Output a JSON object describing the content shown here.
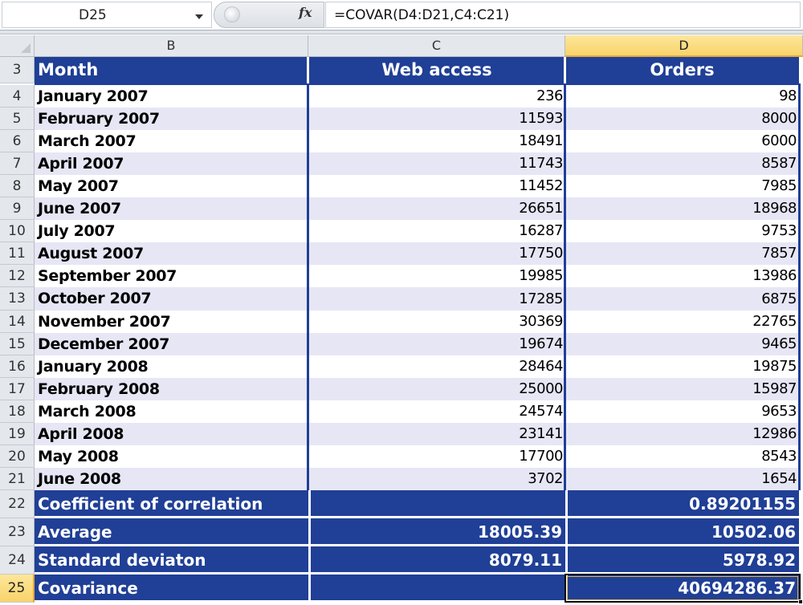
{
  "formula_bar": {
    "name_box": "D25",
    "fx_label": "fx",
    "formula": "=COVAR(D4:D21,C4:C21)"
  },
  "columns": [
    {
      "letter": "B",
      "selected": false
    },
    {
      "letter": "C",
      "selected": false
    },
    {
      "letter": "D",
      "selected": true
    }
  ],
  "header_row": {
    "row_number": "3",
    "month": "Month",
    "web_access": "Web access",
    "orders": "Orders"
  },
  "rows": [
    {
      "row": "4",
      "month": "January 2007",
      "web": "236",
      "orders": "98"
    },
    {
      "row": "5",
      "month": "February 2007",
      "web": "11593",
      "orders": "8000"
    },
    {
      "row": "6",
      "month": "March 2007",
      "web": "18491",
      "orders": "6000"
    },
    {
      "row": "7",
      "month": "April 2007",
      "web": "11743",
      "orders": "8587"
    },
    {
      "row": "8",
      "month": "May 2007",
      "web": "11452",
      "orders": "7985"
    },
    {
      "row": "9",
      "month": "June 2007",
      "web": "26651",
      "orders": "18968"
    },
    {
      "row": "10",
      "month": "July 2007",
      "web": "16287",
      "orders": "9753"
    },
    {
      "row": "11",
      "month": "August 2007",
      "web": "17750",
      "orders": "7857"
    },
    {
      "row": "12",
      "month": "September 2007",
      "web": "19985",
      "orders": "13986"
    },
    {
      "row": "13",
      "month": "October 2007",
      "web": "17285",
      "orders": "6875"
    },
    {
      "row": "14",
      "month": "November 2007",
      "web": "30369",
      "orders": "22765"
    },
    {
      "row": "15",
      "month": "December 2007",
      "web": "19674",
      "orders": "9465"
    },
    {
      "row": "16",
      "month": "January 2008",
      "web": "28464",
      "orders": "19875"
    },
    {
      "row": "17",
      "month": "February 2008",
      "web": "25000",
      "orders": "15987"
    },
    {
      "row": "18",
      "month": "March 2008",
      "web": "24574",
      "orders": "9653"
    },
    {
      "row": "19",
      "month": "April 2008",
      "web": "23141",
      "orders": "12986"
    },
    {
      "row": "20",
      "month": "May 2008",
      "web": "17700",
      "orders": "8543"
    },
    {
      "row": "21",
      "month": "June 2008",
      "web": "3702",
      "orders": "1654"
    }
  ],
  "stats": [
    {
      "row": "22",
      "label": "Coefficient of correlation",
      "web": "",
      "orders": "0.89201155",
      "selected": false
    },
    {
      "row": "23",
      "label": "Average",
      "web": "18005.39",
      "orders": "10502.06",
      "selected": false
    },
    {
      "row": "24",
      "label": "Standard deviaton",
      "web": "8079.11",
      "orders": "5978.92",
      "selected": false
    },
    {
      "row": "25",
      "label": "Covariance",
      "web": "",
      "orders": "40694286.37",
      "selected": true
    }
  ],
  "colors": {
    "header_blue": "#203f96",
    "band": "#e6e6f5",
    "selection_gold": "#f8d36a"
  }
}
